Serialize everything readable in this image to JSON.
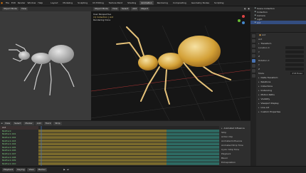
{
  "menus": [
    "File",
    "Edit",
    "Render",
    "Window",
    "Help"
  ],
  "workspaces": [
    {
      "label": "Layout",
      "active": false
    },
    {
      "label": "Modeling",
      "active": false
    },
    {
      "label": "Sculpting",
      "active": false
    },
    {
      "label": "UV Editing",
      "active": false
    },
    {
      "label": "Texture Paint",
      "active": false
    },
    {
      "label": "Shading",
      "active": false
    },
    {
      "label": "Animation",
      "active": true
    },
    {
      "label": "Rendering",
      "active": false
    },
    {
      "label": "Compositing",
      "active": false
    },
    {
      "label": "Geometry Nodes",
      "active": false
    },
    {
      "label": "Scripting",
      "active": false
    }
  ],
  "left_viewport": {
    "mode": "Object Mode",
    "view": "View"
  },
  "main_viewport": {
    "mode": "Object Mode",
    "menus": [
      "View",
      "Select",
      "Add",
      "Object"
    ],
    "overlay_line1": "User Perspective",
    "overlay_line2": "(1) Collection | Ant",
    "overlay_line3": "Rendering Done"
  },
  "right_panel": {
    "outliner_rows": [
      "Scene Collection",
      "Collection",
      "Camera",
      "Light",
      "Ant"
    ],
    "object_name": "Ant",
    "sub_name": "Ant",
    "transform_title": "Transform",
    "transform_rows": [
      "Location X",
      "Y",
      "Z",
      "Rotation X",
      "Y",
      "Z",
      "Mode"
    ],
    "mode_value": "XYZ Euler",
    "sections": [
      "Delta Transform",
      "Relations",
      "Collections",
      "Instancing",
      "Motion Paths",
      "Visibility",
      "Viewport Display",
      "Line Art",
      "Custom Properties"
    ]
  },
  "nla": {
    "menus": [
      "View",
      "Select",
      "Marker",
      "Add",
      "Track",
      "Strip"
    ],
    "tracks": [
      "Ant",
      "NlaTrack",
      "NlaTrack.001",
      "NlaTrack.002",
      "NlaTrack.003",
      "NlaTrack.004",
      "NlaTrack.005",
      "NlaTrack.006",
      "NlaTrack.007",
      "NlaTrack.008",
      "NlaTrack.009",
      "NlaTrack.010"
    ],
    "side_panel_title": "Animated Influence",
    "side_rows": [
      "Strip",
      "Action Clip",
      "Animated Influence",
      "Animated Strip Time",
      "Cyclic Strip Time",
      "Playback",
      "Blend",
      "Extrapolation"
    ]
  },
  "statusbar": {
    "left": "Playback",
    "mid1": "Keying",
    "mid2": "View",
    "mid3": "Marker"
  },
  "colors": {
    "accent": "#4772b3",
    "strip_yellow": "#7a6a2d",
    "strip_teal": "#2e6b63",
    "ant_gold": "#d3a036"
  }
}
